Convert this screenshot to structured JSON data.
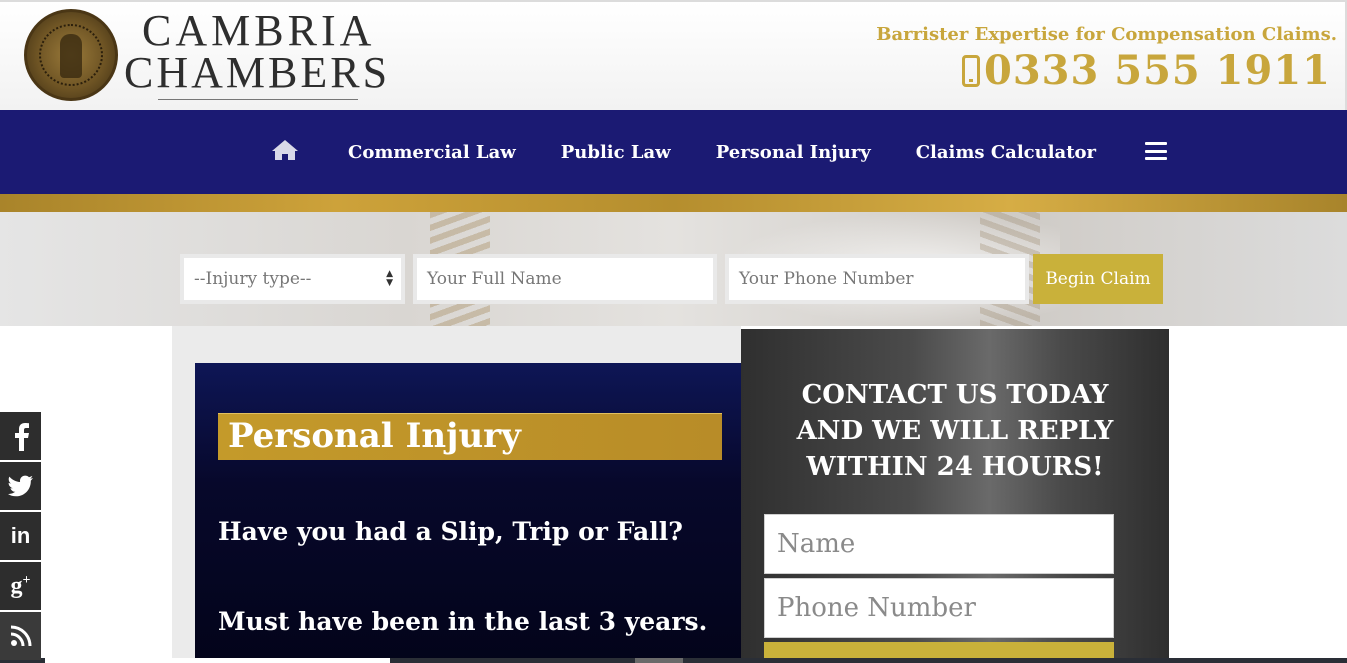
{
  "header": {
    "brand_line1": "CAMBRIA",
    "brand_line2": "CHAMBERS",
    "tagline": "Barrister Expertise for Compensation Claims.",
    "phone": "0333 555 1911"
  },
  "nav": {
    "home_icon": "home-icon",
    "items": [
      {
        "label": "Commercial Law"
      },
      {
        "label": "Public Law"
      },
      {
        "label": "Personal Injury"
      },
      {
        "label": "Claims Calculator"
      }
    ],
    "menu_icon": "hamburger-menu-icon"
  },
  "claim_form": {
    "injury_type": "--Injury type--",
    "full_name_placeholder": "Your Full Name",
    "phone_placeholder": "Your Phone Number",
    "submit_label": "Begin Claim"
  },
  "personal_injury": {
    "title": "Personal Injury",
    "question1": "Have you had a Slip, Trip or Fall?",
    "question2": "Must have been in the last 3 years."
  },
  "contact": {
    "heading_line1": "CONTACT US TODAY",
    "heading_line2": "AND WE WILL REPLY",
    "heading_line3": "WITHIN 24 HOURS!",
    "name_placeholder": "Name",
    "phone_placeholder": "Phone Number"
  },
  "social": {
    "icons": [
      "facebook-icon",
      "twitter-icon",
      "linkedin-icon",
      "google-plus-icon",
      "rss-icon"
    ]
  },
  "colors": {
    "nav_blue": "#1b1a73",
    "gold": "#c9b13a",
    "gold_text": "#c8a63c"
  }
}
